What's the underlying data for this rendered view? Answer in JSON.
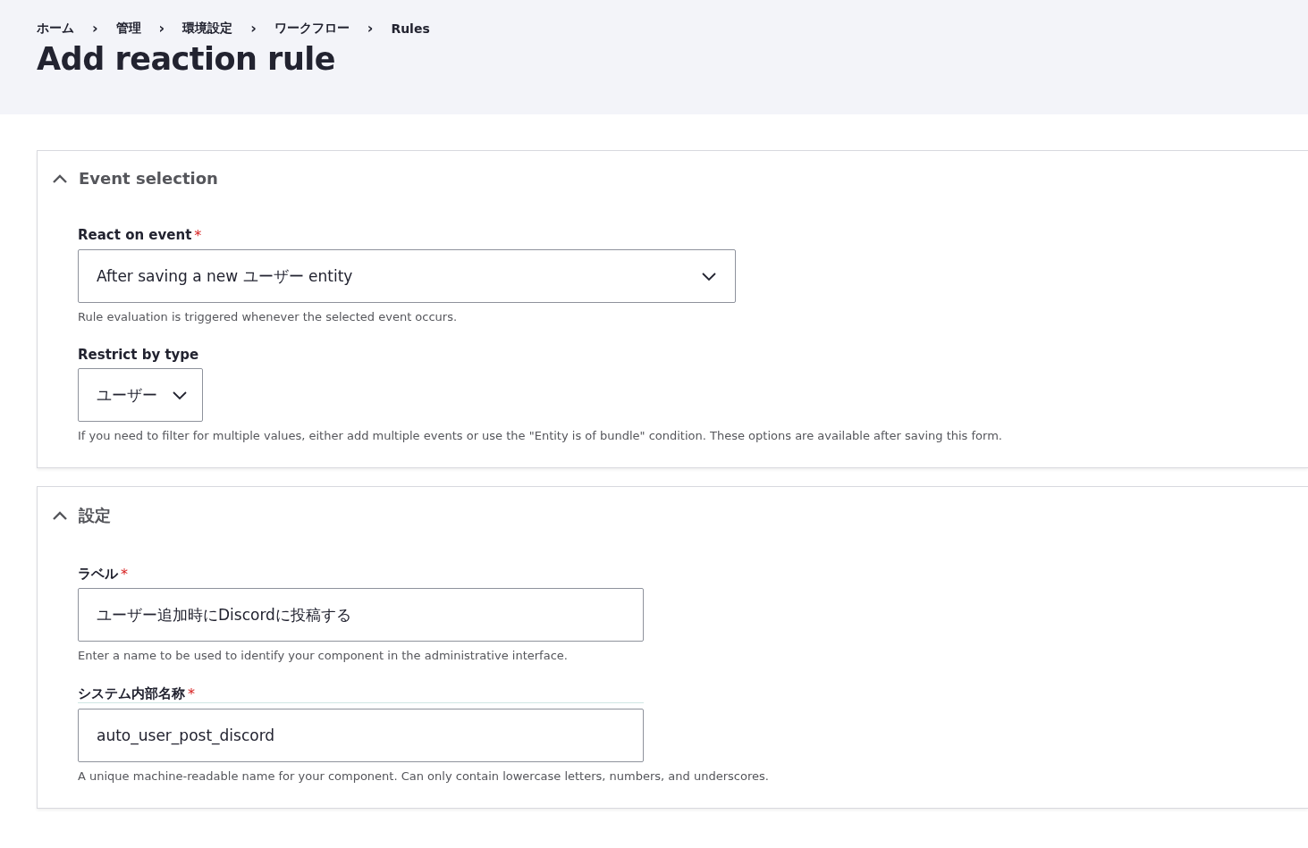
{
  "breadcrumb": [
    {
      "label": "ホーム"
    },
    {
      "label": "管理"
    },
    {
      "label": "環境設定"
    },
    {
      "label": "ワークフロー"
    },
    {
      "label": "Rules"
    }
  ],
  "breadcrumb_separator": "›",
  "title": "Add reaction rule",
  "sections": [
    {
      "title": "Event selection",
      "expanded": true,
      "fields": [
        {
          "kind": "select",
          "label": "React on event",
          "required_mark": "*",
          "value": "After saving a new ユーザー entity",
          "description": "Rule evaluation is triggered whenever the selected event occurs."
        },
        {
          "kind": "select",
          "label": "Restrict by type",
          "value": "ユーザー",
          "description": "If you need to filter for multiple values, either add multiple events or use the \"Entity is of bundle\" condition. These options are available after saving this form."
        }
      ]
    },
    {
      "title": "設定",
      "expanded": true,
      "fields": [
        {
          "kind": "text",
          "label": "ラベル",
          "required_mark": "*",
          "value": "ユーザー追加時にDiscordに投稿する",
          "description": "Enter a name to be used to identify your component in the administrative interface."
        },
        {
          "kind": "text",
          "label": "システム内部名称",
          "required_mark": "*",
          "value": "auto_user_post_discord",
          "description": "A unique machine-readable name for your component. Can only contain lowercase letters, numbers, and underscores."
        }
      ]
    }
  ]
}
